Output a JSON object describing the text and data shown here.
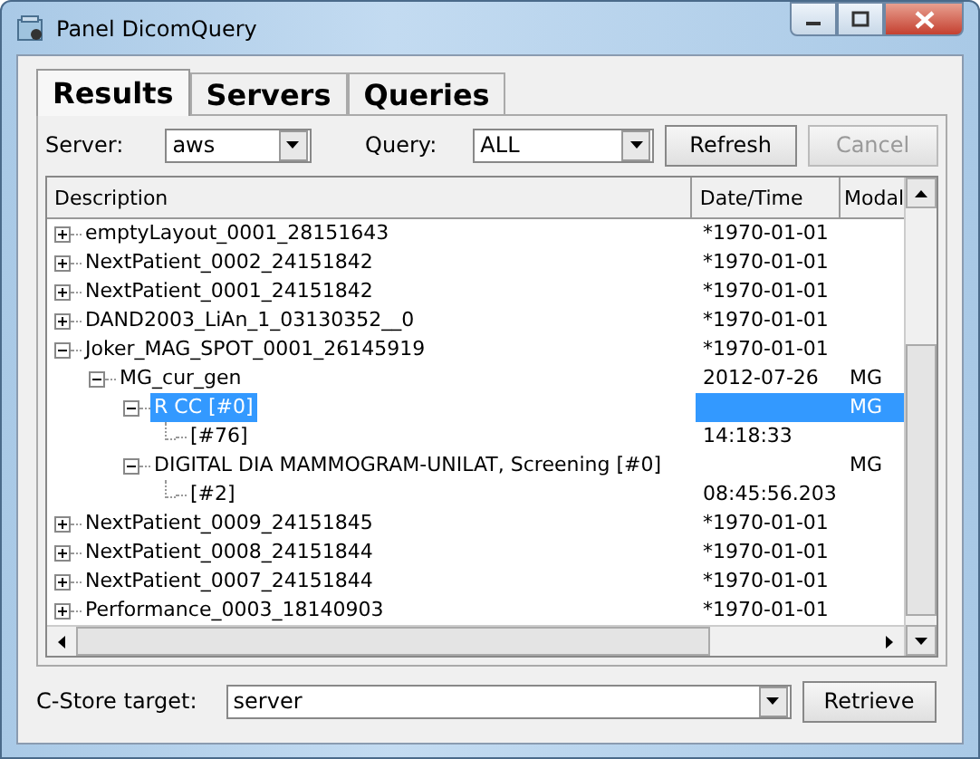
{
  "window": {
    "title": "Panel DicomQuery"
  },
  "tabs": [
    {
      "label": "Results",
      "selected": true
    },
    {
      "label": "Servers",
      "selected": false
    },
    {
      "label": "Queries",
      "selected": false
    }
  ],
  "toolbar": {
    "server_label": "Server:",
    "server": "aws",
    "query_label": "Query:",
    "query": "ALL",
    "refresh": {
      "label": "Refresh",
      "disabled": false
    },
    "cancel": {
      "label": "Cancel",
      "disabled": true
    }
  },
  "tree": {
    "columns": [
      "Description",
      "Date/Time",
      "Modal"
    ],
    "rows": [
      {
        "label": "emptyLayout_0001_28151643",
        "date": "*1970-01-01",
        "expanded": false,
        "selected": false
      },
      {
        "label": "NextPatient_0002_24151842",
        "date": "*1970-01-01",
        "expanded": false,
        "selected": false
      },
      {
        "label": "NextPatient_0001_24151842",
        "date": "*1970-01-01",
        "expanded": false,
        "selected": false
      },
      {
        "label": "DAND2003_LiAn_1_03130352__0",
        "date": "*1970-01-01",
        "expanded": false,
        "selected": false
      },
      {
        "label": "Joker_MAG_SPOT_0001_26145919",
        "date": "*1970-01-01",
        "expanded": true,
        "selected": false,
        "children": [
          {
            "label": "MG_cur_gen",
            "date": "2012-07-26",
            "modality": "MG",
            "expanded": true,
            "selected": false,
            "children": [
              {
                "label": "R CC [#0]",
                "modality": "MG",
                "expanded": true,
                "selected": true,
                "children": [
                  {
                    "label": "[#76]",
                    "date": "14:18:33",
                    "selected": false
                  }
                ]
              },
              {
                "label": "DIGITAL DIA MAMMOGRAM-UNILAT, Screening [#0]",
                "modality": "MG",
                "expanded": true,
                "selected": false,
                "children": [
                  {
                    "label": "[#2]",
                    "date": "08:45:56.203",
                    "selected": false
                  }
                ]
              }
            ]
          }
        ]
      },
      {
        "label": "NextPatient_0009_24151845",
        "date": "*1970-01-01",
        "expanded": false,
        "selected": false
      },
      {
        "label": "NextPatient_0008_24151844",
        "date": "*1970-01-01",
        "expanded": false,
        "selected": false
      },
      {
        "label": "NextPatient_0007_24151844",
        "date": "*1970-01-01",
        "expanded": false,
        "selected": false
      },
      {
        "label": "Performance_0003_18140903",
        "date": "*1970-01-01",
        "expanded": false,
        "selected": false
      }
    ]
  },
  "footer": {
    "label": "C-Store target:",
    "target": "server",
    "retrieve": "Retrieve"
  }
}
